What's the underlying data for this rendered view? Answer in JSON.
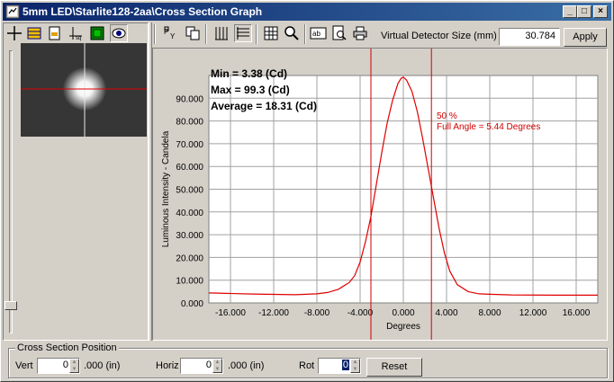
{
  "window": {
    "title": "5mm LED\\Starlite128-2aa\\Cross Section Graph"
  },
  "toolbar": {
    "detector_label": "Virtual Detector Size (mm)",
    "detector_value": "30.784",
    "apply_label": "Apply"
  },
  "stats": {
    "min": "Min = 3.38 (Cd)",
    "max": "Max = 99.3 (Cd)",
    "average": "Average = 18.31 (Cd)"
  },
  "annotation": {
    "percent": "50 %",
    "full_angle": "Full Angle = 5.44 Degrees"
  },
  "chart_data": {
    "type": "line",
    "xlabel": "Degrees",
    "ylabel": "Luminous Intensity - Candela",
    "xlim": [
      -18,
      18
    ],
    "ylim": [
      0,
      100
    ],
    "x_ticks": [
      "-16.000",
      "-12.000",
      "-8.000",
      "-4.000",
      "0.000",
      "4.000",
      "8.000",
      "12.000",
      "16.000"
    ],
    "x_tick_values": [
      -16,
      -12,
      -8,
      -4,
      0,
      4,
      8,
      12,
      16
    ],
    "y_ticks": [
      "0.000",
      "10.000",
      "20.000",
      "30.000",
      "40.000",
      "50.000",
      "60.000",
      "70.000",
      "80.000",
      "90.000"
    ],
    "y_tick_values": [
      0,
      10,
      20,
      30,
      40,
      50,
      60,
      70,
      80,
      90
    ],
    "grid": true,
    "series": [
      {
        "color": "#e00000",
        "x": [
          -18,
          -14,
          -10,
          -8,
          -7,
          -6,
          -5,
          -4.5,
          -4,
          -3.5,
          -3,
          -2.5,
          -2,
          -1.5,
          -1,
          -0.5,
          -0.2,
          0,
          0.3,
          0.8,
          1.3,
          1.8,
          2.3,
          2.8,
          3.3,
          3.8,
          4.3,
          5,
          6,
          7,
          8,
          10,
          14,
          18
        ],
        "y": [
          4.4,
          3.9,
          3.6,
          4.0,
          4.6,
          6.0,
          9.0,
          12.0,
          18.0,
          27.0,
          38.0,
          52.0,
          66.0,
          79.0,
          89.0,
          96.5,
          98.8,
          99.3,
          98.0,
          93.0,
          84.0,
          72.0,
          59.0,
          46.0,
          33.0,
          22.0,
          14.0,
          8.0,
          5.0,
          4.0,
          3.8,
          3.5,
          3.4,
          3.4
        ]
      }
    ],
    "markers_x": [
      -3.0,
      2.6
    ]
  },
  "cross_section": {
    "title": "Cross Section Position",
    "vert_label": "Vert",
    "vert_value": "0",
    "vert_unit": ".000 (in)",
    "horiz_label": "Horiz",
    "horiz_value": "0",
    "horiz_unit": ".000 (in)",
    "rot_label": "Rot",
    "rot_value": "0",
    "reset_label": "Reset"
  }
}
